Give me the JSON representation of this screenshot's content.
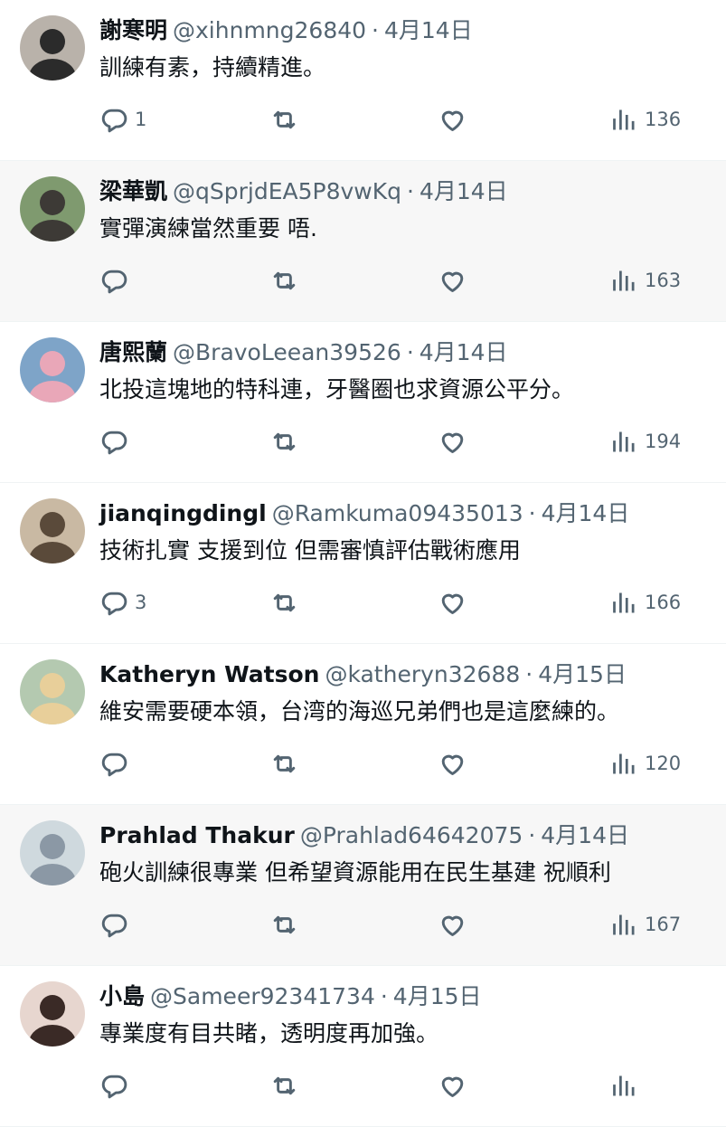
{
  "replies": [
    {
      "name": "謝寒明",
      "handle": "@xihnmng26840",
      "date": "4月14日",
      "text": "訓練有素，持續精進。",
      "reply_count": "1",
      "views": "136",
      "highlight": false,
      "avatar_bg": "#b9b2aa",
      "avatar_fg": "#2b2b2b"
    },
    {
      "name": "梁華凱",
      "handle": "@qSprjdEA5P8vwKq",
      "date": "4月14日",
      "text": "實彈演練當然重要 唔.",
      "reply_count": "",
      "views": "163",
      "highlight": true,
      "avatar_bg": "#7f9a6f",
      "avatar_fg": "#3d3a36"
    },
    {
      "name": "唐熙蘭",
      "handle": "@BravoLeean39526",
      "date": "4月14日",
      "text": "北投這塊地的特科連，牙醫圈也求資源公平分。",
      "reply_count": "",
      "views": "194",
      "highlight": false,
      "avatar_bg": "#7ea4c8",
      "avatar_fg": "#e9a7b8"
    },
    {
      "name": "jianqingdingl",
      "handle": "@Ramkuma09435013",
      "date": "4月14日",
      "text": "技術扎實 支援到位 但需審慎評估戰術應用",
      "reply_count": "3",
      "views": "166",
      "highlight": false,
      "avatar_bg": "#c9b9a3",
      "avatar_fg": "#5a4a3a"
    },
    {
      "name": "Katheryn Watson",
      "handle": "@katheryn32688",
      "date": "4月15日",
      "text": "維安需要硬本領，台湾的海巡兄弟們也是這麼練的。",
      "reply_count": "",
      "views": "120",
      "highlight": false,
      "avatar_bg": "#b4c9b0",
      "avatar_fg": "#e8cf9a"
    },
    {
      "name": "Prahlad Thakur",
      "handle": "@Prahlad64642075",
      "date": "4月14日",
      "text": "砲火訓練很專業 但希望資源能用在民生基建 祝順利",
      "reply_count": "",
      "views": "167",
      "highlight": true,
      "avatar_bg": "#cfd9de",
      "avatar_fg": "#8b98a5"
    },
    {
      "name": "小島",
      "handle": "@Sameer92341734",
      "date": "4月15日",
      "text": "專業度有目共睹，透明度再加強。",
      "reply_count": "",
      "views": "",
      "highlight": false,
      "avatar_bg": "#e7d6cf",
      "avatar_fg": "#3a2a26"
    }
  ],
  "separator": "·",
  "icons": {
    "reply": "reply-icon",
    "retweet": "retweet-icon",
    "like": "like-icon",
    "views": "views-icon"
  }
}
